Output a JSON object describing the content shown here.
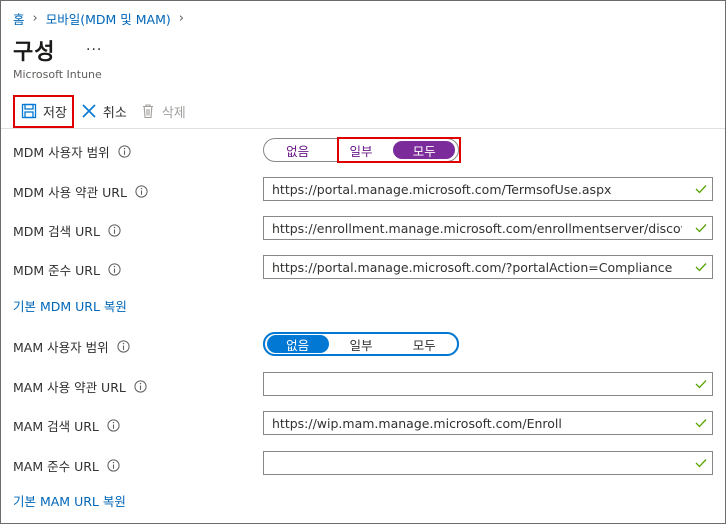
{
  "breadcrumb": {
    "home": "홈",
    "parent": "모바일(MDM 및 MAM)"
  },
  "page": {
    "title": "구성",
    "more": "...",
    "subtitle": "Microsoft Intune"
  },
  "toolbar": {
    "save_label": "저장",
    "discard_label": "취소",
    "delete_label": "삭제"
  },
  "mdm": {
    "scope_label": "MDM 사용자 범위",
    "scope_options": [
      "없음",
      "일부",
      "모두"
    ],
    "scope_selected": "모두",
    "terms_label": "MDM 사용 약관 URL",
    "terms_value": "https://portal.manage.microsoft.com/TermsofUse.aspx",
    "discovery_label": "MDM 검색 URL",
    "discovery_value": "https://enrollment.manage.microsoft.com/enrollmentserver/discovery.svc",
    "compliance_label": "MDM 준수 URL",
    "compliance_value": "https://portal.manage.microsoft.com/?portalAction=Compliance",
    "restore_link": "기본 MDM URL 복원"
  },
  "mam": {
    "scope_label": "MAM 사용자 범위",
    "scope_options": [
      "없음",
      "일부",
      "모두"
    ],
    "scope_selected": "없음",
    "terms_label": "MAM 사용 약관 URL",
    "terms_value": "",
    "discovery_label": "MAM 검색 URL",
    "discovery_value": "https://wip.mam.manage.microsoft.com/Enroll",
    "compliance_label": "MAM 준수 URL",
    "compliance_value": "",
    "restore_link": "기본 MAM URL 복원"
  },
  "colors": {
    "link": "#0066b8",
    "mdm_accent": "#7b2b9a",
    "mam_accent": "#0078d4",
    "valid_check": "#57a300",
    "highlight": "#e00000"
  },
  "icons": {
    "save": "save-icon",
    "discard": "close-icon",
    "delete": "trash-icon",
    "info": "info-icon",
    "valid": "checkmark-icon"
  }
}
